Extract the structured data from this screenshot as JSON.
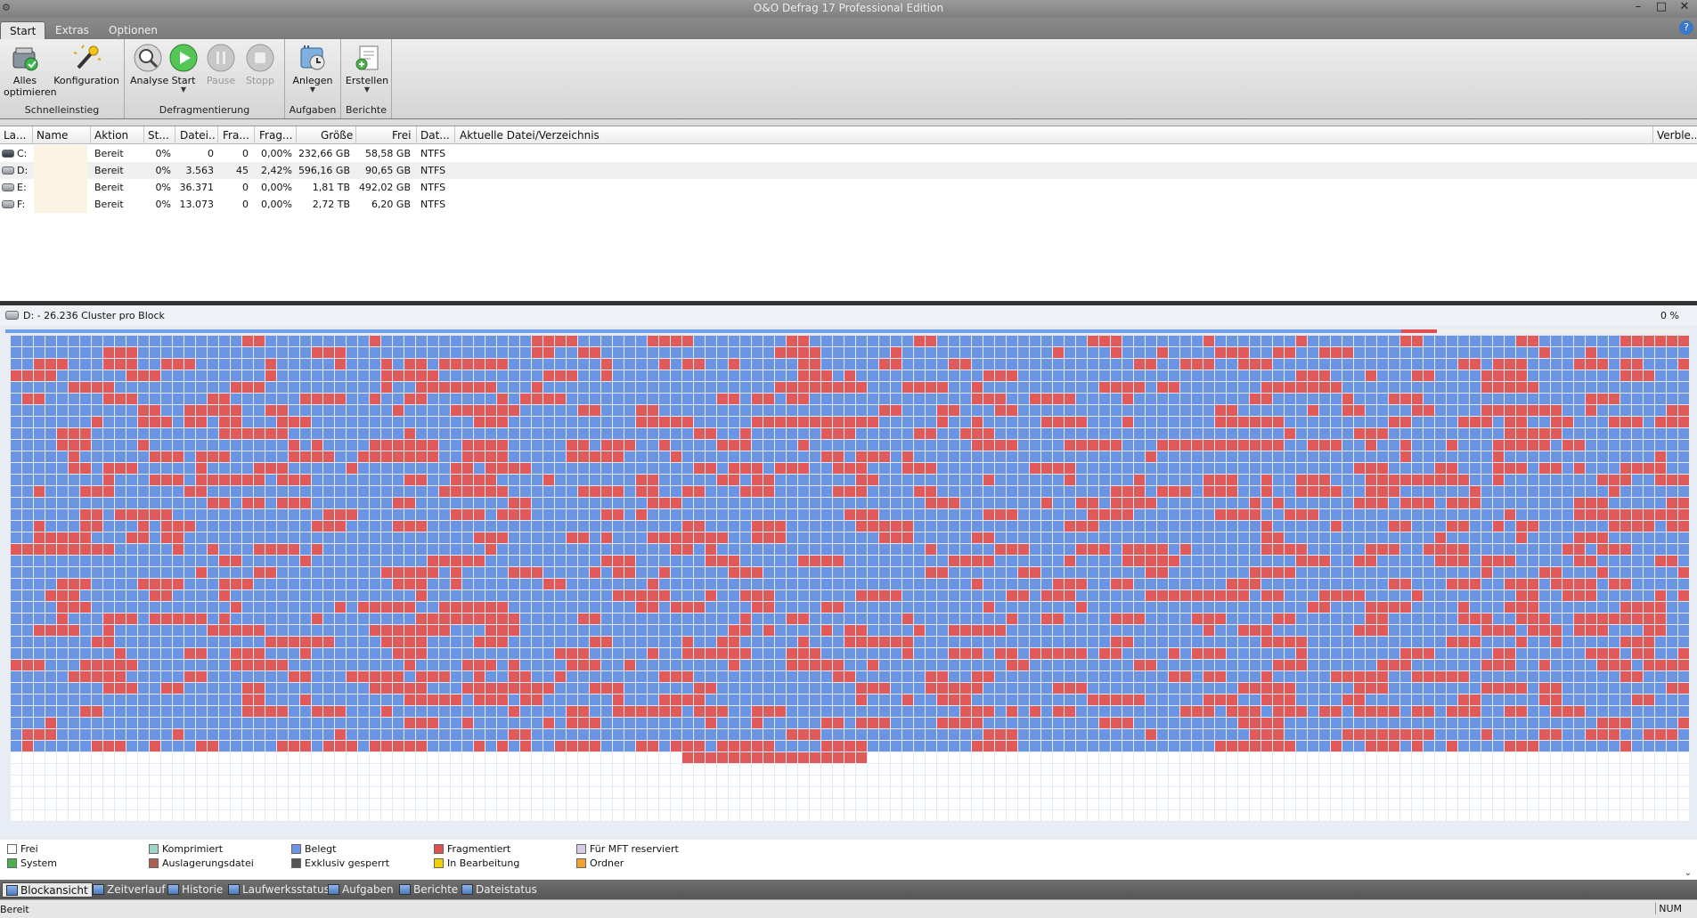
{
  "window": {
    "title": "O&O Defrag 17 Professional Edition"
  },
  "tabs": [
    {
      "label": "Start",
      "active": true
    },
    {
      "label": "Extras",
      "active": false
    },
    {
      "label": "Optionen",
      "active": false
    }
  ],
  "ribbon": {
    "groups": [
      {
        "label": "Schnelleinstieg",
        "buttons": [
          {
            "label": "Alles optimieren"
          },
          {
            "label": "Konfiguration"
          }
        ]
      },
      {
        "label": "Defragmentierung",
        "buttons": [
          {
            "label": "Analyse"
          },
          {
            "label": "Start"
          },
          {
            "label": "Pause",
            "disabled": true
          },
          {
            "label": "Stopp",
            "disabled": true
          }
        ]
      },
      {
        "label": "Aufgaben",
        "buttons": [
          {
            "label": "Anlegen"
          }
        ]
      },
      {
        "label": "Berichte",
        "buttons": [
          {
            "label": "Erstellen"
          }
        ]
      }
    ]
  },
  "drive_list": {
    "columns": [
      "La...",
      "Name",
      "Aktion",
      "St...",
      "Datei...",
      "Fra...",
      "Frag...",
      "Größe",
      "Frei",
      "Dat...",
      "Aktuelle Datei/Verzeichnis",
      "Verble..."
    ],
    "rows": [
      {
        "drive": "C:",
        "name": "",
        "action": "Bereit",
        "status": "0%",
        "files": "0",
        "frag_files": "0",
        "frag_pct": "0,00%",
        "size": "232,66 GB",
        "free": "58,58 GB",
        "fs": "NTFS"
      },
      {
        "drive": "D:",
        "name": "",
        "action": "Bereit",
        "status": "0%",
        "files": "3.563",
        "frag_files": "45",
        "frag_pct": "2,42%",
        "size": "596,16 GB",
        "free": "90,65 GB",
        "fs": "NTFS"
      },
      {
        "drive": "E:",
        "name": "",
        "action": "Bereit",
        "status": "0%",
        "files": "36.371",
        "frag_files": "0",
        "frag_pct": "0,00%",
        "size": "1,81 TB",
        "free": "492,02 GB",
        "fs": "NTFS"
      },
      {
        "drive": "F:",
        "name": "",
        "action": "Bereit",
        "status": "0%",
        "files": "13.073",
        "frag_files": "0",
        "frag_pct": "0,00%",
        "size": "2,72 TB",
        "free": "6,20 GB",
        "fs": "NTFS"
      }
    ]
  },
  "block_map": {
    "title": "D: - 26.236 Cluster pro Block",
    "progress_text": "0 %",
    "progress_fraction": 0.85,
    "colors": {
      "free": "#ffffff",
      "used": "#6b95e3",
      "fragmented": "#e05a5a",
      "grid": "#e3e9f3"
    }
  },
  "legend": [
    {
      "label": "Frei",
      "color": "#ffffff"
    },
    {
      "label": "System",
      "color": "#4caf50"
    },
    {
      "label": "Komprimiert",
      "color": "#9fd3c7"
    },
    {
      "label": "Auslagerungsdatei",
      "color": "#b06050"
    },
    {
      "label": "Belegt",
      "color": "#6b95e3"
    },
    {
      "label": "Exklusiv gesperrt",
      "color": "#555555"
    },
    {
      "label": "Fragmentiert",
      "color": "#e05050"
    },
    {
      "label": "In Bearbeitung",
      "color": "#f0d000"
    },
    {
      "label": "Für MFT reserviert",
      "color": "#d8c8e8"
    },
    {
      "label": "Ordner",
      "color": "#f0a030"
    }
  ],
  "view_tabs": [
    {
      "label": "Blockansicht",
      "active": true
    },
    {
      "label": "Zeitverlauf"
    },
    {
      "label": "Historie"
    },
    {
      "label": "Laufwerksstatus"
    },
    {
      "label": "Aufgaben"
    },
    {
      "label": "Berichte"
    },
    {
      "label": "Dateistatus"
    }
  ],
  "status": {
    "text": "Bereit",
    "num": "NUM"
  }
}
